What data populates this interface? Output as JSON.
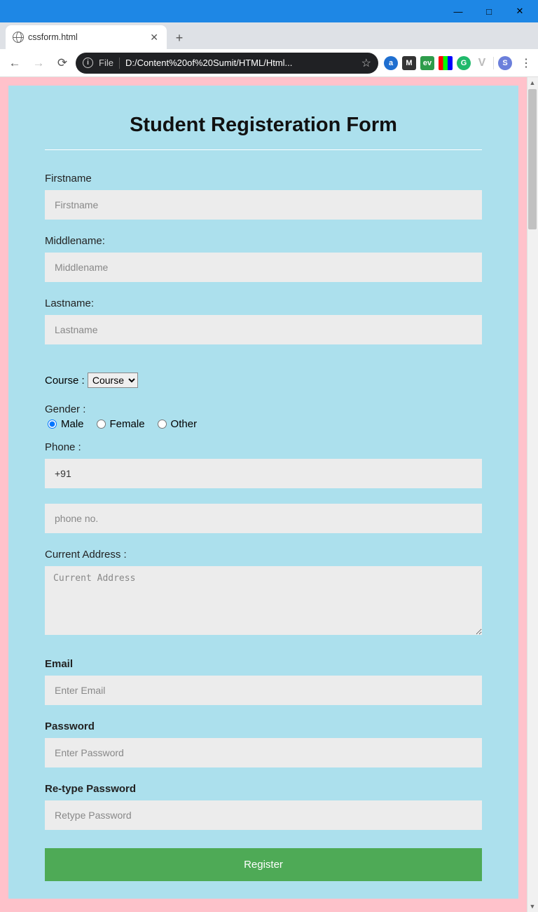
{
  "browser": {
    "tab_title": "cssform.html",
    "address_scheme": "File",
    "address_path": "D:/Content%20of%20Sumit/HTML/Html...",
    "extensions": [
      "a",
      "M",
      "ev",
      "col",
      "G",
      "V",
      "S"
    ]
  },
  "form": {
    "title": "Student Registeration Form",
    "firstname_label": "Firstname",
    "firstname_placeholder": "Firstname",
    "middlename_label": "Middlename:",
    "middlename_placeholder": "Middlename",
    "lastname_label": "Lastname:",
    "lastname_placeholder": "Lastname",
    "course_label": "Course :",
    "course_selected": "Course",
    "gender_label": "Gender :",
    "gender_options": {
      "male": "Male",
      "female": "Female",
      "other": "Other"
    },
    "gender_selected": "male",
    "phone_label": "Phone :",
    "phone_prefix_value": "+91",
    "phone_placeholder": "phone no.",
    "address_label": "Current Address :",
    "address_placeholder": "Current Address",
    "email_label": "Email",
    "email_placeholder": "Enter Email",
    "password_label": "Password",
    "password_placeholder": "Enter Password",
    "repassword_label": "Re-type Password",
    "repassword_placeholder": "Retype Password",
    "submit_label": "Register"
  }
}
